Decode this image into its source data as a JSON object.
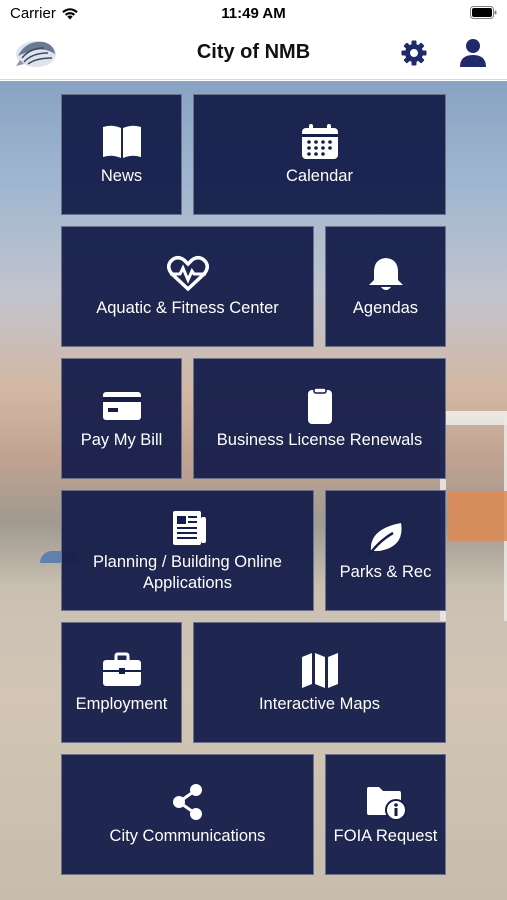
{
  "status_bar": {
    "carrier": "Carrier",
    "time": "11:49 AM"
  },
  "nav": {
    "title": "City of NMB",
    "logo_icon": "seashell-icon",
    "settings_icon": "gear-icon",
    "profile_icon": "user-icon"
  },
  "colors": {
    "tile_background": "#151e4a",
    "tile_text": "#ffffff",
    "nav_icon": "#1f2a6b"
  },
  "tiles": [
    {
      "label": "News",
      "icon": "book-icon"
    },
    {
      "label": "Calendar",
      "icon": "calendar-icon"
    },
    {
      "label": "Aquatic & Fitness Center",
      "icon": "heartbeat-icon"
    },
    {
      "label": "Agendas",
      "icon": "bell-icon"
    },
    {
      "label": "Pay My Bill",
      "icon": "credit-card-icon"
    },
    {
      "label": "Business License Renewals",
      "icon": "clipboard-icon"
    },
    {
      "label": "Planning / Building Online Applications",
      "icon": "newspaper-icon"
    },
    {
      "label": "Parks & Rec",
      "icon": "leaf-icon"
    },
    {
      "label": "Employment",
      "icon": "briefcase-icon"
    },
    {
      "label": "Interactive Maps",
      "icon": "map-icon"
    },
    {
      "label": "City Communications",
      "icon": "share-icon"
    },
    {
      "label": "FOIA Request",
      "icon": "folder-info-icon"
    }
  ]
}
